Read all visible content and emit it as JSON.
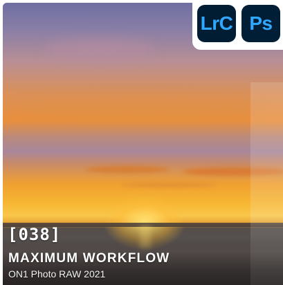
{
  "thumbnail": {
    "episode": "[038]",
    "title": "MAXIMUM WORKFLOW",
    "subtitle": "ON1 Photo RAW 2021"
  },
  "badges": [
    {
      "icon": "lightroom-classic-icon",
      "label": "LrC",
      "color": "#31a8ff",
      "background": "#001d34"
    },
    {
      "icon": "photoshop-icon",
      "label": "Ps",
      "color": "#31a8ff",
      "background": "#001e36"
    }
  ]
}
